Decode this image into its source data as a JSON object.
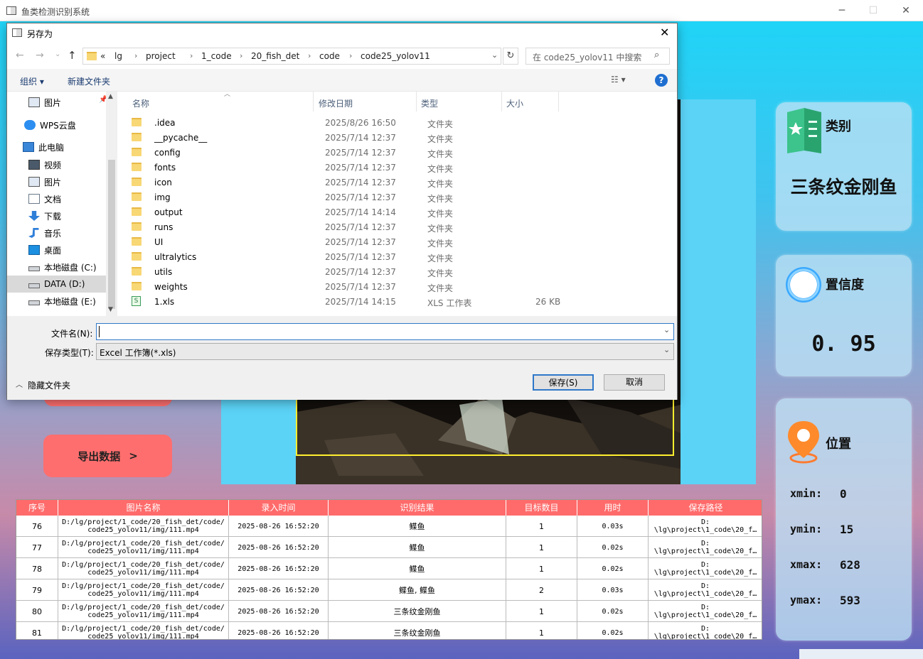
{
  "main": {
    "title": "鱼类检测识别系统",
    "export_label": "导出数据",
    "export_arrow": ">",
    "category": {
      "title": "类别",
      "value": "三条纹金刚鱼"
    },
    "confidence": {
      "title": "置信度",
      "value": "0. 95"
    },
    "position": {
      "title": "位置",
      "xmin_label": "xmin:",
      "xmin": "0",
      "ymin_label": "ymin:",
      "ymin": "15",
      "xmax_label": "xmax:",
      "xmax": "628",
      "ymax_label": "ymax:",
      "ymax": "593"
    }
  },
  "table": {
    "headers": [
      "序号",
      "图片名称",
      "录入时间",
      "识别结果",
      "目标数目",
      "用时",
      "保存路径"
    ],
    "rows": [
      {
        "id": "76",
        "name1": "D:/lg/project/1_code/20_fish_det/code/",
        "name2": "code25_yolov11/img/111.mp4",
        "time": "2025-08-26 16:52:20",
        "result": "鲽鱼",
        "count": "1",
        "dur": "0.03s",
        "path1": "D:",
        "path2": "\\lg\\project\\1_code\\20_f…"
      },
      {
        "id": "77",
        "name1": "D:/lg/project/1_code/20_fish_det/code/",
        "name2": "code25_yolov11/img/111.mp4",
        "time": "2025-08-26 16:52:20",
        "result": "鲽鱼",
        "count": "1",
        "dur": "0.02s",
        "path1": "D:",
        "path2": "\\lg\\project\\1_code\\20_f…"
      },
      {
        "id": "78",
        "name1": "D:/lg/project/1_code/20_fish_det/code/",
        "name2": "code25_yolov11/img/111.mp4",
        "time": "2025-08-26 16:52:20",
        "result": "鲽鱼",
        "count": "1",
        "dur": "0.02s",
        "path1": "D:",
        "path2": "\\lg\\project\\1_code\\20_f…"
      },
      {
        "id": "79",
        "name1": "D:/lg/project/1_code/20_fish_det/code/",
        "name2": "code25_yolov11/img/111.mp4",
        "time": "2025-08-26 16:52:20",
        "result": "鲽鱼, 鲽鱼",
        "count": "2",
        "dur": "0.03s",
        "path1": "D:",
        "path2": "\\lg\\project\\1_code\\20_f…"
      },
      {
        "id": "80",
        "name1": "D:/lg/project/1_code/20_fish_det/code/",
        "name2": "code25_yolov11/img/111.mp4",
        "time": "2025-08-26 16:52:20",
        "result": "三条纹金刚鱼",
        "count": "1",
        "dur": "0.02s",
        "path1": "D:",
        "path2": "\\lg\\project\\1_code\\20_f…"
      },
      {
        "id": "81",
        "name1": "D:/lg/project/1_code/20_fish_det/code/",
        "name2": "code25_yolov11/img/111.mp4",
        "time": "2025-08-26 16:52:20",
        "result": "三条纹金刚鱼",
        "count": "1",
        "dur": "0.02s",
        "path1": "D:",
        "path2": "\\lg\\project\\1_code\\20_f…"
      }
    ]
  },
  "dialog": {
    "title": "另存为",
    "close": "✕",
    "breadcrumb": [
      "«",
      "lg",
      "project",
      "1_code",
      "20_fish_det",
      "code",
      "code25_yolov11"
    ],
    "search_placeholder": "在 code25_yolov11 中搜索",
    "organize": "组织 ▾",
    "new_folder": "新建文件夹",
    "help": "?",
    "nav": [
      {
        "label": "图片",
        "icon": "pictures-icon"
      },
      {
        "label": "WPS云盘",
        "icon": "cloud-icon"
      },
      {
        "label": "此电脑",
        "icon": "computer-icon"
      },
      {
        "label": "视频",
        "icon": "video-icon"
      },
      {
        "label": "图片",
        "icon": "pictures-icon"
      },
      {
        "label": "文档",
        "icon": "document-icon"
      },
      {
        "label": "下载",
        "icon": "download-icon"
      },
      {
        "label": "音乐",
        "icon": "music-icon"
      },
      {
        "label": "桌面",
        "icon": "desktop-icon"
      },
      {
        "label": "本地磁盘 (C:)",
        "icon": "drive-icon"
      },
      {
        "label": "DATA (D:)",
        "icon": "drive-icon"
      },
      {
        "label": "本地磁盘 (E:)",
        "icon": "drive-icon"
      }
    ],
    "columns": {
      "name": "名称",
      "date": "修改日期",
      "type": "类型",
      "size": "大小"
    },
    "files": [
      {
        "name": ".idea",
        "date": "2025/8/26 16:50",
        "type": "文件夹",
        "size": ""
      },
      {
        "name": "__pycache__",
        "date": "2025/7/14 12:37",
        "type": "文件夹",
        "size": ""
      },
      {
        "name": "config",
        "date": "2025/7/14 12:37",
        "type": "文件夹",
        "size": ""
      },
      {
        "name": "fonts",
        "date": "2025/7/14 12:37",
        "type": "文件夹",
        "size": ""
      },
      {
        "name": "icon",
        "date": "2025/7/14 12:37",
        "type": "文件夹",
        "size": ""
      },
      {
        "name": "img",
        "date": "2025/7/14 12:37",
        "type": "文件夹",
        "size": ""
      },
      {
        "name": "output",
        "date": "2025/7/14 14:14",
        "type": "文件夹",
        "size": ""
      },
      {
        "name": "runs",
        "date": "2025/7/14 12:37",
        "type": "文件夹",
        "size": ""
      },
      {
        "name": "UI",
        "date": "2025/7/14 12:37",
        "type": "文件夹",
        "size": ""
      },
      {
        "name": "ultralytics",
        "date": "2025/7/14 12:37",
        "type": "文件夹",
        "size": ""
      },
      {
        "name": "utils",
        "date": "2025/7/14 12:37",
        "type": "文件夹",
        "size": ""
      },
      {
        "name": "weights",
        "date": "2025/7/14 12:37",
        "type": "文件夹",
        "size": ""
      },
      {
        "name": "1.xls",
        "date": "2025/7/14 14:15",
        "type": "XLS 工作表",
        "size": "26 KB"
      }
    ],
    "filename_label": "文件名(N):",
    "filename_value": "",
    "filetype_label": "保存类型(T):",
    "filetype_value": "Excel 工作簿(*.xls)",
    "hide_folders": "隐藏文件夹",
    "save": "保存(S)",
    "cancel": "取消"
  }
}
